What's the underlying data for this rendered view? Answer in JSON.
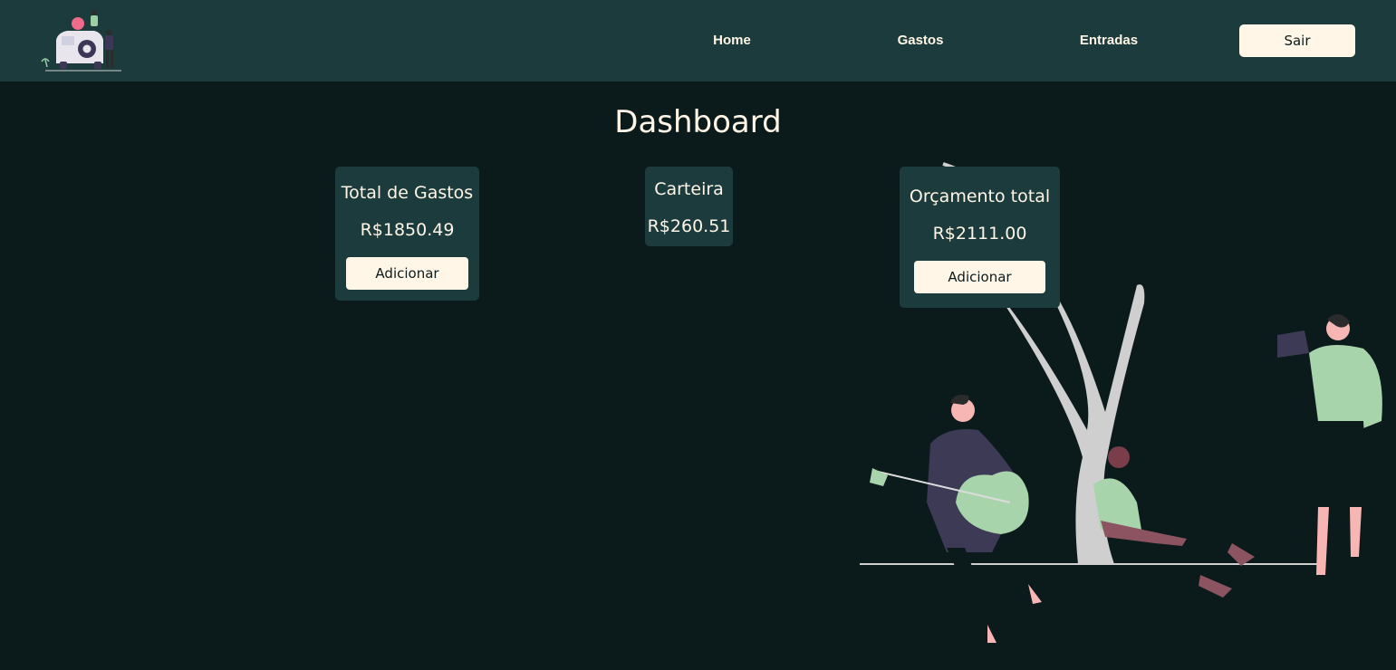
{
  "nav": {
    "home": "Home",
    "gastos": "Gastos",
    "entradas": "Entradas",
    "logout": "Sair"
  },
  "page": {
    "title": "Dashboard"
  },
  "cards": {
    "gastos": {
      "title": "Total de Gastos",
      "value": "R$1850.49",
      "button": "Adicionar"
    },
    "carteira": {
      "title": "Carteira",
      "value": "R$260.51"
    },
    "orcamento": {
      "title": "Orçamento total",
      "value": "R$2111.00",
      "button": "Adicionar"
    }
  },
  "colors": {
    "navbar": "#1c3b3d",
    "background": "#0b1a1b",
    "card": "#1c3b3d",
    "button": "#fff6e8",
    "text": "#fff6e6"
  },
  "icons": {
    "logo": "logo-car-people-icon",
    "illustration": "music-park-illustration"
  }
}
